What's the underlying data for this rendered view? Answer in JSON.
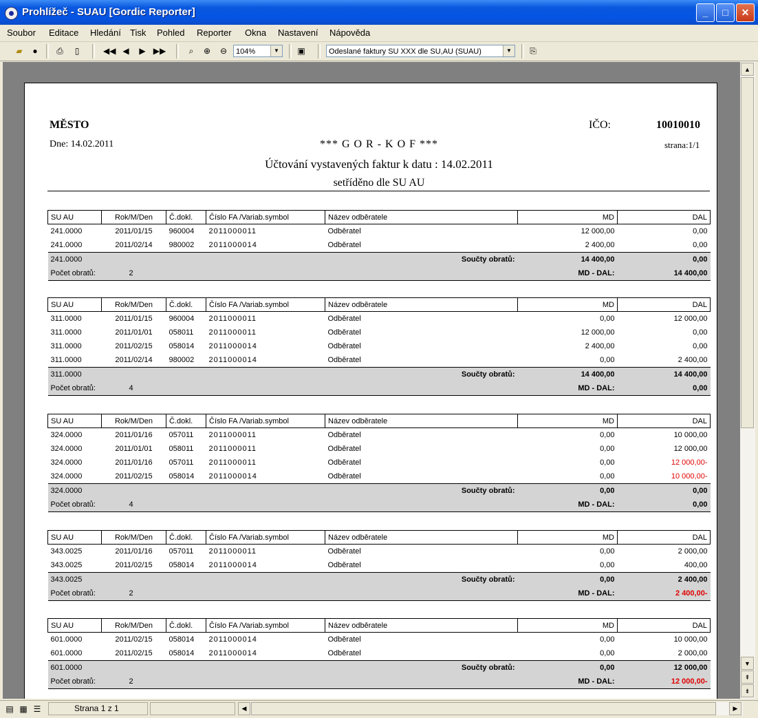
{
  "window": {
    "title": "Prohlížeč - SUAU [Gordic Reporter]"
  },
  "menu": [
    "Soubor",
    "Editace",
    "Hledání",
    "Tisk",
    "Pohled",
    "Reporter",
    "Okna",
    "Nastavení",
    "Nápověda"
  ],
  "toolbar": {
    "zoom": "104%",
    "report": "Odeslané faktury SU XXX dle SU,AU (SUAU)"
  },
  "status": {
    "page": "Strana 1 z 1"
  },
  "report": {
    "city": "MĚSTO",
    "ico_label": "IČO:",
    "ico": "10010010",
    "date": "Dne: 14.02.2011",
    "org": "*** G O R - K O F ***",
    "page_no": "strana:1/1",
    "title": "Účtování vystavených faktur k datu : 14.02.2011",
    "subtitle": "setříděno dle SU AU",
    "columns": {
      "su": "SU   AU",
      "date": "Rok/M/Den",
      "doc": "Č.dokl.",
      "fa": "Číslo FA /Variab.symbol",
      "name": "Název odběratele",
      "md": "MD",
      "dal": "DAL"
    },
    "labels": {
      "soucty": "Součty obratů:",
      "pocet": "Počet obratů:",
      "mddal": "MD - DAL:"
    },
    "groups": [
      {
        "su": "241.0000",
        "count": "2",
        "sum_md": "14 400,00",
        "sum_dal": "0,00",
        "diff": "14 400,00",
        "diff_neg": false,
        "rows": [
          {
            "su": "241.0000",
            "date": "2011/01/15",
            "doc": "960004",
            "fa": "2011000011",
            "name": "Odběratel",
            "md": "12 000,00",
            "dal": "0,00",
            "neg": false
          },
          {
            "su": "241.0000",
            "date": "2011/02/14",
            "doc": "980002",
            "fa": "2011000014",
            "name": "Odběratel",
            "md": "2 400,00",
            "dal": "0,00",
            "neg": false
          }
        ]
      },
      {
        "su": "311.0000",
        "count": "4",
        "sum_md": "14 400,00",
        "sum_dal": "14 400,00",
        "diff": "0,00",
        "diff_neg": false,
        "rows": [
          {
            "su": "311.0000",
            "date": "2011/01/15",
            "doc": "960004",
            "fa": "2011000011",
            "name": "Odběratel",
            "md": "0,00",
            "dal": "12 000,00",
            "neg": false
          },
          {
            "su": "311.0000",
            "date": "2011/01/01",
            "doc": "058011",
            "fa": "2011000011",
            "name": "Odběratel",
            "md": "12 000,00",
            "dal": "0,00",
            "neg": false
          },
          {
            "su": "311.0000",
            "date": "2011/02/15",
            "doc": "058014",
            "fa": "2011000014",
            "name": "Odběratel",
            "md": "2 400,00",
            "dal": "0,00",
            "neg": false
          },
          {
            "su": "311.0000",
            "date": "2011/02/14",
            "doc": "980002",
            "fa": "2011000014",
            "name": "Odběratel",
            "md": "0,00",
            "dal": "2 400,00",
            "neg": false
          }
        ]
      },
      {
        "su": "324.0000",
        "count": "4",
        "sum_md": "0,00",
        "sum_dal": "0,00",
        "diff": "0,00",
        "diff_neg": false,
        "rows": [
          {
            "su": "324.0000",
            "date": "2011/01/16",
            "doc": "057011",
            "fa": "2011000011",
            "name": "Odběratel",
            "md": "0,00",
            "dal": "10 000,00",
            "neg": false
          },
          {
            "su": "324.0000",
            "date": "2011/01/01",
            "doc": "058011",
            "fa": "2011000011",
            "name": "Odběratel",
            "md": "0,00",
            "dal": "12 000,00",
            "neg": false
          },
          {
            "su": "324.0000",
            "date": "2011/01/16",
            "doc": "057011",
            "fa": "2011000011",
            "name": "Odběratel",
            "md": "0,00",
            "dal": "12 000,00-",
            "neg": true
          },
          {
            "su": "324.0000",
            "date": "2011/02/15",
            "doc": "058014",
            "fa": "2011000014",
            "name": "Odběratel",
            "md": "0,00",
            "dal": "10 000,00-",
            "neg": true
          }
        ]
      },
      {
        "su": "343.0025",
        "count": "2",
        "sum_md": "0,00",
        "sum_dal": "2 400,00",
        "diff": "2 400,00-",
        "diff_neg": true,
        "rows": [
          {
            "su": "343.0025",
            "date": "2011/01/16",
            "doc": "057011",
            "fa": "2011000011",
            "name": "Odběratel",
            "md": "0,00",
            "dal": "2 000,00",
            "neg": false
          },
          {
            "su": "343.0025",
            "date": "2011/02/15",
            "doc": "058014",
            "fa": "2011000014",
            "name": "Odběratel",
            "md": "0,00",
            "dal": "400,00",
            "neg": false
          }
        ]
      },
      {
        "su": "601.0000",
        "count": "2",
        "sum_md": "0,00",
        "sum_dal": "12 000,00",
        "diff": "12 000,00-",
        "diff_neg": true,
        "rows": [
          {
            "su": "601.0000",
            "date": "2011/02/15",
            "doc": "058014",
            "fa": "2011000014",
            "name": "Odběratel",
            "md": "0,00",
            "dal": "10 000,00",
            "neg": false
          },
          {
            "su": "601.0000",
            "date": "2011/02/15",
            "doc": "058014",
            "fa": "2011000014",
            "name": "Odběratel",
            "md": "0,00",
            "dal": "2 000,00",
            "neg": false
          }
        ]
      }
    ]
  }
}
